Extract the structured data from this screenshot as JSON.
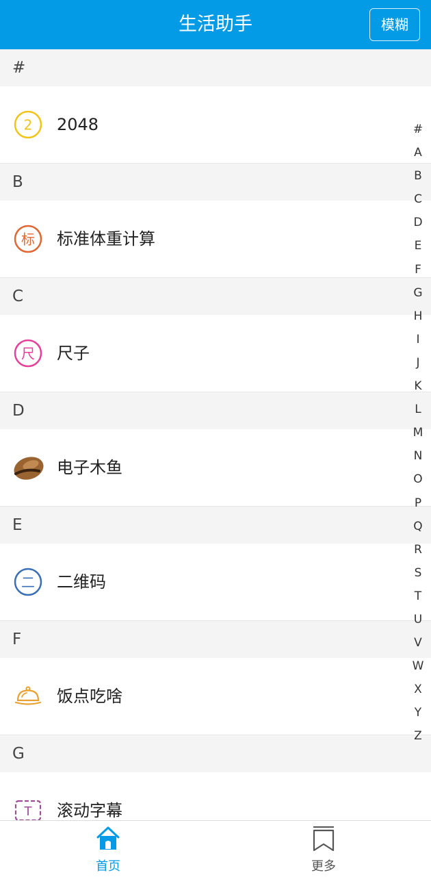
{
  "header": {
    "title": "生活助手",
    "blur_button": "模糊"
  },
  "sections": [
    {
      "letter": "#",
      "item": {
        "label": "2048",
        "icon": "circle-2-icon",
        "color": "#f0c419"
      }
    },
    {
      "letter": "B",
      "item": {
        "label": "标准体重计算",
        "icon": "circle-biao-icon",
        "color": "#e06633"
      }
    },
    {
      "letter": "C",
      "item": {
        "label": "尺子",
        "icon": "circle-chi-icon",
        "color": "#e6409a"
      }
    },
    {
      "letter": "D",
      "item": {
        "label": "电子木鱼",
        "icon": "wooden-fish-icon",
        "color": "#8b5a2b"
      }
    },
    {
      "letter": "E",
      "item": {
        "label": "二维码",
        "icon": "circle-er-icon",
        "color": "#3a6fb5"
      }
    },
    {
      "letter": "F",
      "item": {
        "label": "饭点吃啥",
        "icon": "food-cloche-icon",
        "color": "#e8a030"
      }
    },
    {
      "letter": "G",
      "item": {
        "label": "滚动字幕",
        "icon": "scrolling-text-icon",
        "color": "#9b4d96"
      }
    }
  ],
  "index_letters": [
    "#",
    "A",
    "B",
    "C",
    "D",
    "E",
    "F",
    "G",
    "H",
    "I",
    "J",
    "K",
    "L",
    "M",
    "N",
    "O",
    "P",
    "Q",
    "R",
    "S",
    "T",
    "U",
    "V",
    "W",
    "X",
    "Y",
    "Z"
  ],
  "tabbar": {
    "home": {
      "label": "首页",
      "active_color": "#039be5"
    },
    "more": {
      "label": "更多",
      "color": "#555555"
    }
  }
}
